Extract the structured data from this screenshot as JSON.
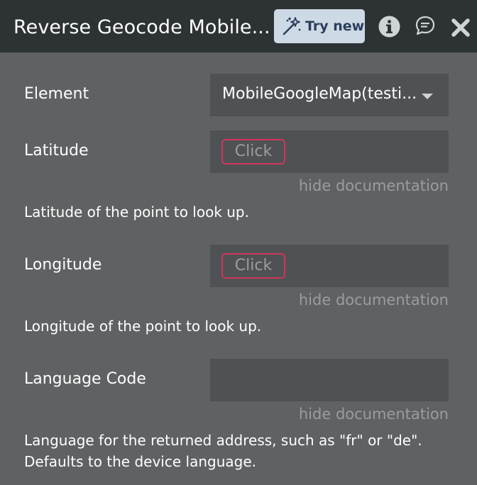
{
  "header": {
    "title": "Reverse Geocode Mobile...",
    "try_new_label": "Try new"
  },
  "fields": {
    "element": {
      "label": "Element",
      "value": "MobileGoogleMap(testi..."
    },
    "latitude": {
      "label": "Latitude",
      "placeholder": "Click",
      "hide_doc": "hide documentation",
      "doc": "Latitude of the point to look up."
    },
    "longitude": {
      "label": "Longitude",
      "placeholder": "Click",
      "hide_doc": "hide documentation",
      "doc": "Longitude of the point to look up."
    },
    "language": {
      "label": "Language Code",
      "value": "",
      "hide_doc": "hide documentation",
      "doc_line1": "Language for the returned address, such as \"fr\" or \"de\".",
      "doc_line2": "Defaults to the device language."
    }
  },
  "colors": {
    "header_bg": "#2d3234",
    "panel_bg": "#5f6163",
    "field_bg": "#4f5254",
    "accent_border": "#d0355a",
    "button_bg": "#cdd9e5"
  },
  "icons": {
    "try_new": "magic-wand-icon",
    "info": "info-icon",
    "chat": "chat-icon",
    "close": "close-icon",
    "dropdown": "caret-down-icon"
  }
}
